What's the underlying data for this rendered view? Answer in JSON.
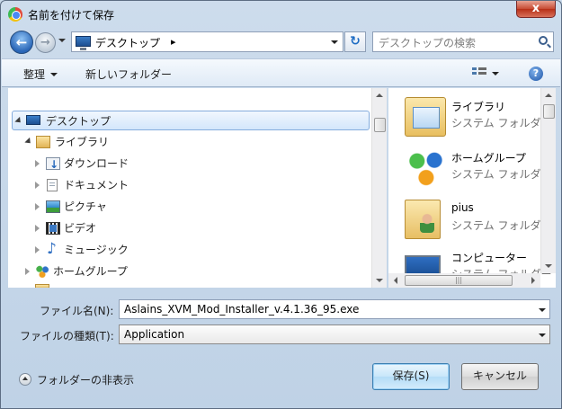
{
  "window": {
    "title": "名前を付けて保存",
    "close_label": "x"
  },
  "nav": {
    "back_glyph": "←",
    "forward_glyph": "→",
    "address_text": "デスクトップ",
    "address_separator": "▸",
    "refresh_glyph": "↻",
    "search_placeholder": "デスクトップの検索"
  },
  "toolbar": {
    "organize_label": "整理",
    "new_folder_label": "新しいフォルダー",
    "help_glyph": "?"
  },
  "tree": {
    "items": [
      {
        "label": "デスクトップ",
        "icon": "desktop-icon",
        "expanded": true,
        "selected": true
      },
      {
        "label": "ライブラリ",
        "icon": "library-icon",
        "expanded": true
      },
      {
        "label": "ダウンロード",
        "icon": "download-folder-icon"
      },
      {
        "label": "ドキュメント",
        "icon": "document-icon"
      },
      {
        "label": "ピクチャ",
        "icon": "picture-icon"
      },
      {
        "label": "ビデオ",
        "icon": "video-icon"
      },
      {
        "label": "ミュージック",
        "icon": "music-icon"
      },
      {
        "label": "ホームグループ",
        "icon": "homegroup-icon"
      }
    ]
  },
  "content": {
    "items": [
      {
        "name": "ライブラリ",
        "type": "システム フォルダー",
        "icon": "library-icon"
      },
      {
        "name": "ホームグループ",
        "type": "システム フォルダー",
        "icon": "homegroup-icon"
      },
      {
        "name": "pius",
        "type": "システム フォルダー",
        "icon": "user-folder-icon"
      },
      {
        "name": "コンピューター",
        "type": "システム フォルダー",
        "icon": "computer-icon"
      }
    ],
    "hscroll_grip": "|||"
  },
  "form": {
    "filename_label": "ファイル名(N):",
    "filename_value": "Aslains_XVM_Mod_Installer_v.4.1.36_95.exe",
    "filetype_label": "ファイルの種類(T):",
    "filetype_value": "Application"
  },
  "footer": {
    "hide_folders_label": "フォルダーの非表示",
    "save_label": "保存(S)",
    "cancel_label": "キャンセル"
  }
}
